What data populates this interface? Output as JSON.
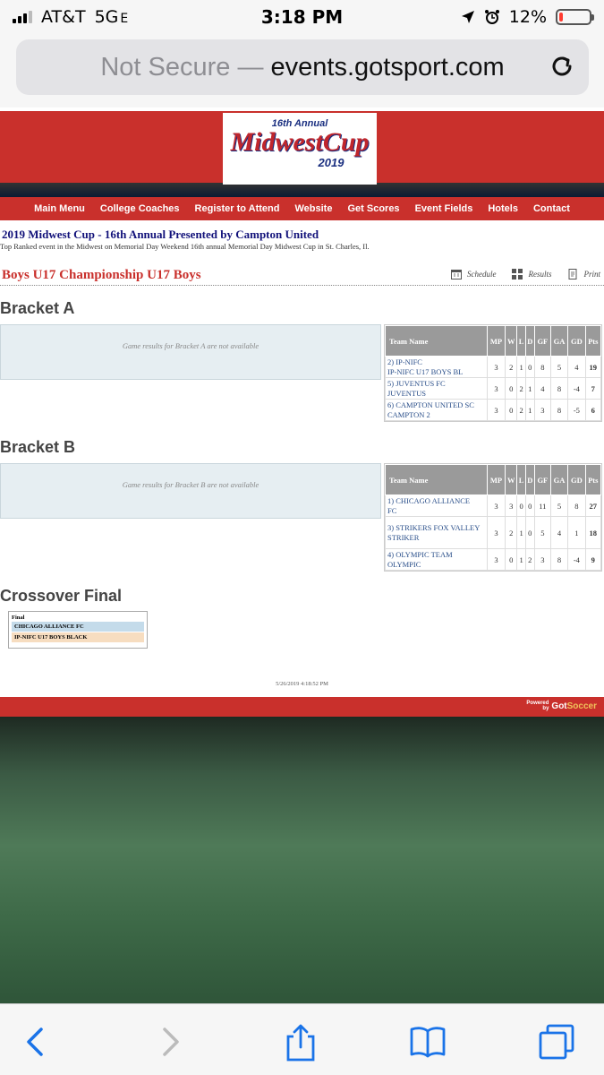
{
  "status": {
    "carrier": "AT&T",
    "network": "5G",
    "network_sub": "E",
    "time": "3:18 PM",
    "battery": "12%",
    "battery_level": 0.12
  },
  "browser": {
    "not_secure": "Not Secure",
    "separator": " — ",
    "domain": "events.gotsport.com"
  },
  "logo": {
    "top": "16th Annual",
    "main": "MidwestCup",
    "year": "2019"
  },
  "nav": [
    "Main Menu",
    "College Coaches",
    "Register to Attend",
    "Website",
    "Get Scores",
    "Event Fields",
    "Hotels",
    "Contact"
  ],
  "event": {
    "title": "2019 Midwest Cup - 16th Annual Presented by Campton United",
    "subtitle": "Top Ranked event in the Midwest on Memorial Day Weekend 16th annual Memorial Day Midwest Cup in St. Charles, Il."
  },
  "division": {
    "title": "Boys U17 Championship U17 Boys",
    "tools": [
      "Schedule",
      "Results",
      "Print"
    ]
  },
  "standings_headers": [
    "Team Name",
    "MP",
    "W",
    "L",
    "D",
    "GF",
    "GA",
    "GD",
    "Pts"
  ],
  "bracket_a": {
    "title": "Bracket A",
    "notice": "Game results for Bracket A are not available",
    "rows": [
      {
        "team_line1": "2) IP-NIFC",
        "team_line2": "IP-NIFC U17 BOYS BL",
        "mp": "3",
        "w": "2",
        "l": "1",
        "d": "0",
        "gf": "8",
        "ga": "5",
        "gd": "4",
        "pts": "19"
      },
      {
        "team_line1": "5) JUVENTUS FC",
        "team_line2": "JUVENTUS",
        "mp": "3",
        "w": "0",
        "l": "2",
        "d": "1",
        "gf": "4",
        "ga": "8",
        "gd": "-4",
        "pts": "7"
      },
      {
        "team_line1": "6) CAMPTON UNITED SC",
        "team_line2": "CAMPTON 2",
        "mp": "3",
        "w": "0",
        "l": "2",
        "d": "1",
        "gf": "3",
        "ga": "8",
        "gd": "-5",
        "pts": "6"
      }
    ]
  },
  "bracket_b": {
    "title": "Bracket B",
    "notice": "Game results for Bracket B are not available",
    "rows": [
      {
        "team_line1": "1) CHICAGO ALLIANCE",
        "team_line2": "FC",
        "mp": "3",
        "w": "3",
        "l": "0",
        "d": "0",
        "gf": "11",
        "ga": "5",
        "gd": "8",
        "pts": "27"
      },
      {
        "team_line1": "3) STRIKERS FOX VALLEY",
        "team_line2": "STRIKER",
        "mp": "3",
        "w": "2",
        "l": "1",
        "d": "0",
        "gf": "5",
        "ga": "4",
        "gd": "1",
        "pts": "18"
      },
      {
        "team_line1": "4) OLYMPIC TEAM",
        "team_line2": "OLYMPIC",
        "mp": "3",
        "w": "0",
        "l": "1",
        "d": "2",
        "gf": "3",
        "ga": "8",
        "gd": "-4",
        "pts": "9"
      }
    ]
  },
  "crossover": {
    "title": "Crossover Final",
    "label": "Final",
    "team1": "CHICAGO ALLIANCE FC",
    "team2": "IP-NIFC U17 BOYS BLACK"
  },
  "timestamp": "5/26/2019 4:18:52 PM",
  "footer": {
    "powered": "Powered",
    "by": "by",
    "brand_a": "Got",
    "brand_b": "Soccer"
  }
}
